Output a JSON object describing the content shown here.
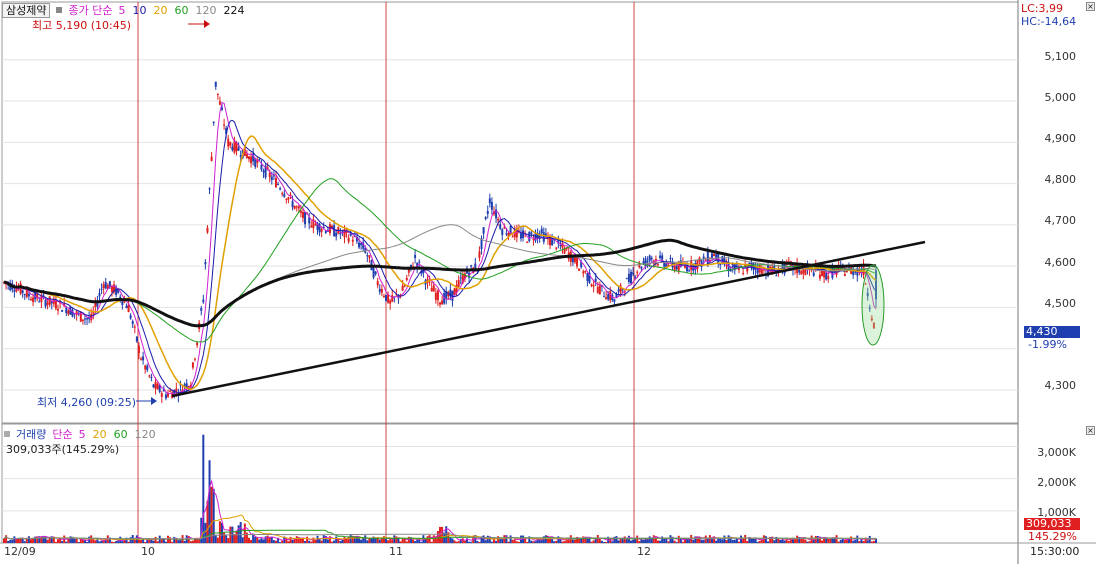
{
  "stock_name": "삼성제약",
  "price_legend": {
    "label": "종가 단순",
    "periods": [
      {
        "value": "5",
        "color": "#d020d0"
      },
      {
        "value": "10",
        "color": "#1a1aaa"
      },
      {
        "value": "20",
        "color": "#e0a000"
      },
      {
        "value": "60",
        "color": "#20a020"
      },
      {
        "value": "120",
        "color": "#888888"
      },
      {
        "value": "224",
        "color": "#111111"
      }
    ]
  },
  "volume_legend": {
    "label": "거래량",
    "ma_label": "단순",
    "periods": [
      {
        "value": "5",
        "color": "#d020d0"
      },
      {
        "value": "20",
        "color": "#e0a000"
      },
      {
        "value": "60",
        "color": "#20a020"
      },
      {
        "value": "120",
        "color": "#888888"
      }
    ],
    "volume_text": "309,033주(145.29%)"
  },
  "annotations": {
    "high": "최고 5,190 (10:45)",
    "low": "최저 4,260 (09:25)"
  },
  "lc_hc": {
    "lc": "LC:3,99",
    "hc": "HC:-14,64"
  },
  "price_axis_ticks": [
    "5,100",
    "5,000",
    "4,900",
    "4,800",
    "4,700",
    "4,600",
    "4,500",
    "4,300"
  ],
  "current_price": {
    "value": "4,430",
    "change": "-1.99%",
    "bg": "#1f3fb0"
  },
  "volume_axis_ticks": [
    "3,000K",
    "2,000K",
    "1,000K"
  ],
  "current_volume": {
    "value": "309,033",
    "pct": "145.29%",
    "bg": "#e02020"
  },
  "date_labels": [
    "12/09",
    "10",
    "11",
    "12"
  ],
  "time_label": "15:30:00",
  "colors": {
    "up": "#e02020",
    "down": "#1f3fb0",
    "divider": "#d04040"
  },
  "chart_data": {
    "type": "line",
    "price_ylim": [
      4220,
      5240
    ],
    "volume_ylim": [
      0,
      3700000
    ],
    "price_series": [
      4560,
      4550,
      4530,
      4520,
      4510,
      4500,
      4480,
      4470,
      4560,
      4540,
      4500,
      4380,
      4310,
      4290,
      4300,
      4320,
      4520,
      5040,
      4900,
      4880,
      4860,
      4830,
      4800,
      4760,
      4720,
      4700,
      4690,
      4680,
      4670,
      4640,
      4560,
      4510,
      4540,
      4620,
      4560,
      4520,
      4530,
      4580,
      4600,
      4760,
      4690,
      4680,
      4670,
      4680,
      4660,
      4640,
      4610,
      4570,
      4540,
      4520,
      4560,
      4600,
      4620,
      4610,
      4600,
      4600,
      4610,
      4630,
      4600,
      4590,
      4600,
      4590,
      4590,
      4600,
      4590,
      4590,
      4580,
      4590,
      4590,
      4590,
      4430
    ],
    "volume_ma5_peak": "2,000K"
  }
}
